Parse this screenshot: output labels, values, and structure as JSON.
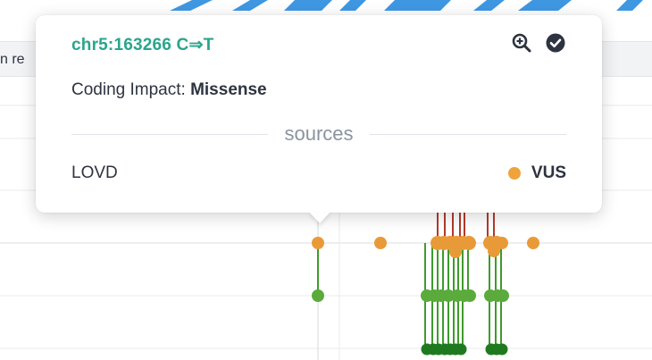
{
  "panel": {
    "left_label": "n re"
  },
  "tooltip": {
    "title": "chr5:163266 C⇒T",
    "impact_label": "Coding Impact:",
    "impact_value": "Missense",
    "sources_heading": "sources",
    "source_name": "LOVD",
    "classification": "VUS",
    "icons": [
      "zoom-in-icon",
      "check-circle-icon"
    ]
  },
  "colors": {
    "title": "#2aa58b",
    "vus": "#f0a33a",
    "orange_marker": "#e99a38",
    "green_light": "#5aaa3c",
    "green_dark": "#1f7a1f",
    "stem_red": "#b33a2a"
  }
}
